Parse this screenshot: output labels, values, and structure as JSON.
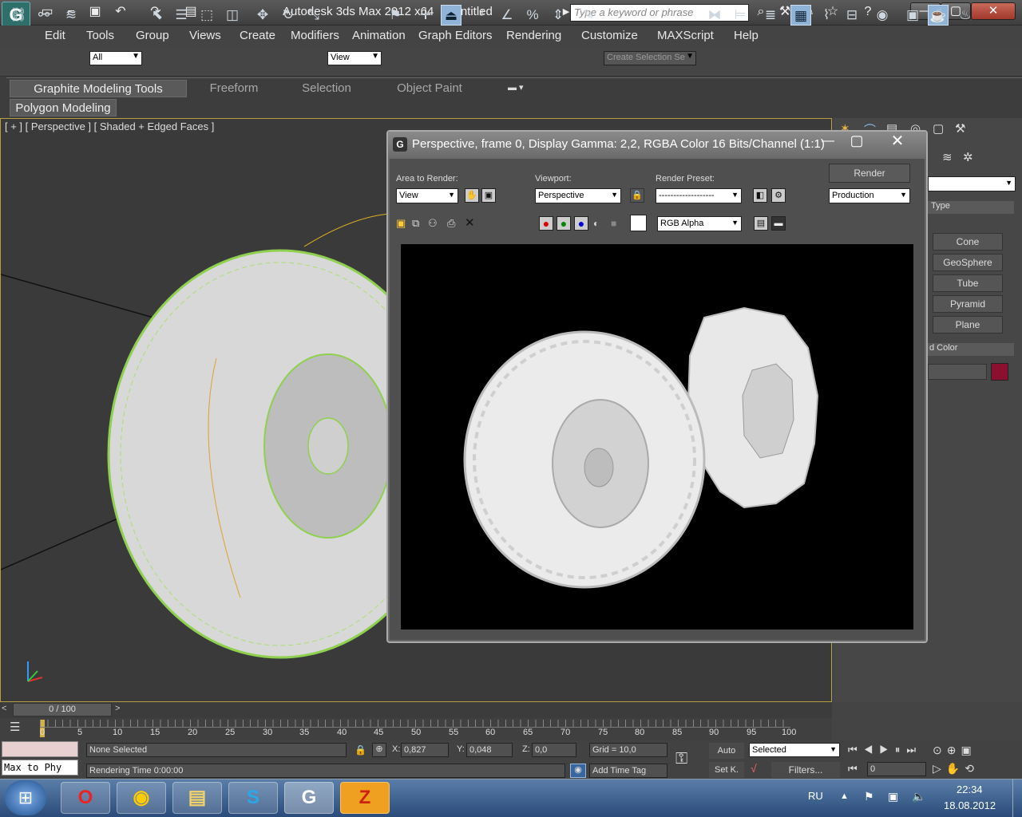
{
  "app": {
    "title": "Autodesk 3ds Max  2012 x64",
    "file": "Untitled",
    "logo_glyph": "G",
    "search_placeholder": "Type a keyword or phrase"
  },
  "menu": [
    "Edit",
    "Tools",
    "Group",
    "Views",
    "Create",
    "Modifiers",
    "Animation",
    "Graph Editors",
    "Rendering",
    "Customize",
    "MAXScript",
    "Help"
  ],
  "toolbar": {
    "filter": "All",
    "ref_coord": "View",
    "selection_set": "Create Selection Se"
  },
  "ribbon": {
    "tabs": [
      "Graphite Modeling Tools",
      "Freeform",
      "Selection",
      "Object Paint"
    ],
    "sub_tab": "Polygon Modeling"
  },
  "viewport": {
    "label": "[ + ] [ Perspective ] [ Shaded + Edged Faces ]"
  },
  "command_panel": {
    "section_type": "Type",
    "primitives": [
      "Cone",
      "GeoSphere",
      "Tube",
      "Pyramid",
      "Plane"
    ],
    "section_color": "d Color",
    "object_color": "#8b1030"
  },
  "render_frame": {
    "title": "Perspective, frame 0, Display Gamma: 2,2, RGBA Color 16 Bits/Channel (1:1)",
    "area_label": "Area to Render:",
    "area_value": "View",
    "viewport_label": "Viewport:",
    "viewport_value": "Perspective",
    "preset_label": "Render Preset:",
    "preset_value": "-------------------",
    "render_button": "Render",
    "production": "Production",
    "channel": "RGB Alpha"
  },
  "timeline": {
    "frame_display": "0 / 100",
    "ticks": [
      "0",
      "5",
      "10",
      "15",
      "20",
      "25",
      "30",
      "35",
      "40",
      "45",
      "50",
      "55",
      "60",
      "65",
      "70",
      "75",
      "80",
      "85",
      "90",
      "95",
      "100"
    ]
  },
  "status": {
    "selection": "None Selected",
    "rendering_time": "Rendering Time  0:00:00",
    "x": "0,827",
    "y": "0,048",
    "z": "0,0",
    "grid": "Grid = 10,0",
    "add_time_tag": "Add Time Tag",
    "auto": "Auto",
    "set_key": "Set K.",
    "selected": "Selected",
    "filters": "Filters...",
    "frame": "0",
    "script_listener": "Max to Phy",
    "x_label": "X:",
    "y_label": "Y:",
    "z_label": "Z:"
  },
  "taskbar": {
    "lang": "RU",
    "time": "22:34",
    "date": "18.08.2012"
  }
}
